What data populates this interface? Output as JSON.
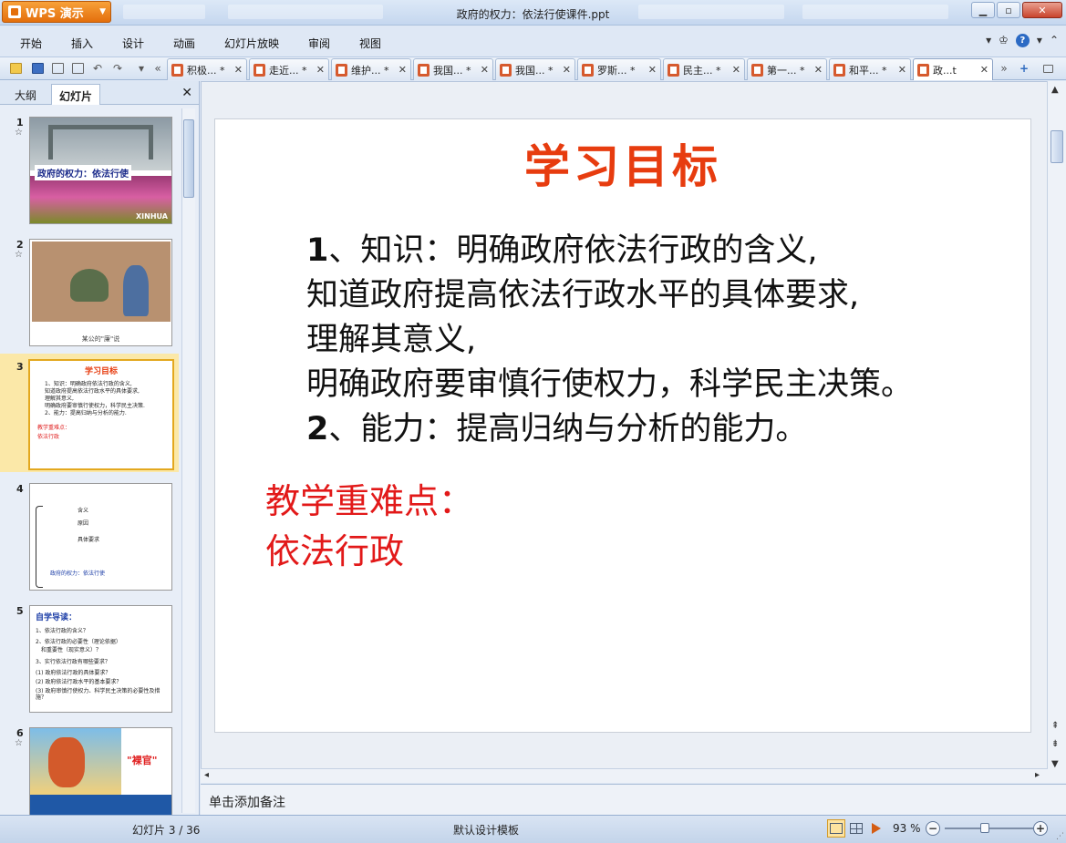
{
  "app": {
    "name": "WPS 演示",
    "doc_title": "政府的权力：依法行使课件.ppt"
  },
  "menu": [
    "开始",
    "插入",
    "设计",
    "动画",
    "幻灯片放映",
    "审阅",
    "视图"
  ],
  "tabs": [
    {
      "label": "积极... *"
    },
    {
      "label": "走近... *"
    },
    {
      "label": "维护... *"
    },
    {
      "label": "我国... *"
    },
    {
      "label": "我国... *"
    },
    {
      "label": "罗斯... *"
    },
    {
      "label": "民主... *"
    },
    {
      "label": "第一... *"
    },
    {
      "label": "和平... *"
    },
    {
      "label": "政...t",
      "active": true
    }
  ],
  "left_panel": {
    "tabs": [
      "大纲",
      "幻灯片"
    ],
    "active_tab": "幻灯片"
  },
  "thumbnails": {
    "t1": {
      "num": "1",
      "title": "政府的权力：依法行使",
      "mark": "XINHUA"
    },
    "t2": {
      "num": "2",
      "caption": "某公的\"廉\"说"
    },
    "t3": {
      "num": "3",
      "title": "学习目标",
      "lines": [
        "1、知识：明确政府依法行政的含义,",
        "知道政府提高依法行政水平的具体要求,",
        "理解其意义,",
        "明确政府要审慎行使权力，科学民主决策.",
        "2、能力：提高归纳与分析的能力."
      ],
      "red": [
        "教学重难点：",
        "依法行政"
      ]
    },
    "t4": {
      "num": "4",
      "lines": [
        "含义",
        "原因",
        "具体要求",
        "政府的权力：依法行使"
      ]
    },
    "t5": {
      "num": "5",
      "title": "自学导读：",
      "lines": [
        "1、依法行政的含义？",
        "2、依法行政的必要性（理论依据）",
        "和重要性（现实意义）？",
        "3、实行依法行政有哪些要求？",
        "(1) 政府依法行政的具体要求？",
        "(2) 政府依法行政水平的基本要求？",
        "(3) 政府审慎行使权力、科学民主决策的必要性及措施？"
      ]
    },
    "t6": {
      "num": "6",
      "label": "\"裸官\""
    }
  },
  "slide": {
    "title": "学习目标",
    "body": [
      {
        "num": "1",
        "text": "、知识：明确政府依法行政的含义,"
      },
      {
        "num": "",
        "text": "知道政府提高依法行政水平的具体要求,"
      },
      {
        "num": "",
        "text": "理解其意义,"
      },
      {
        "num": "",
        "text": "明确政府要审慎行使权力，科学民主决策。"
      },
      {
        "num": "2",
        "text": "、能力：提高归纳与分析的能力。"
      }
    ],
    "red": [
      "教学重难点：",
      "依法行政"
    ]
  },
  "notes_placeholder": "单击添加备注",
  "status": {
    "slide": "幻灯片 3 / 36",
    "template": "默认设计模板",
    "zoom": "93 %",
    "zoom_fraction": 0.45
  }
}
